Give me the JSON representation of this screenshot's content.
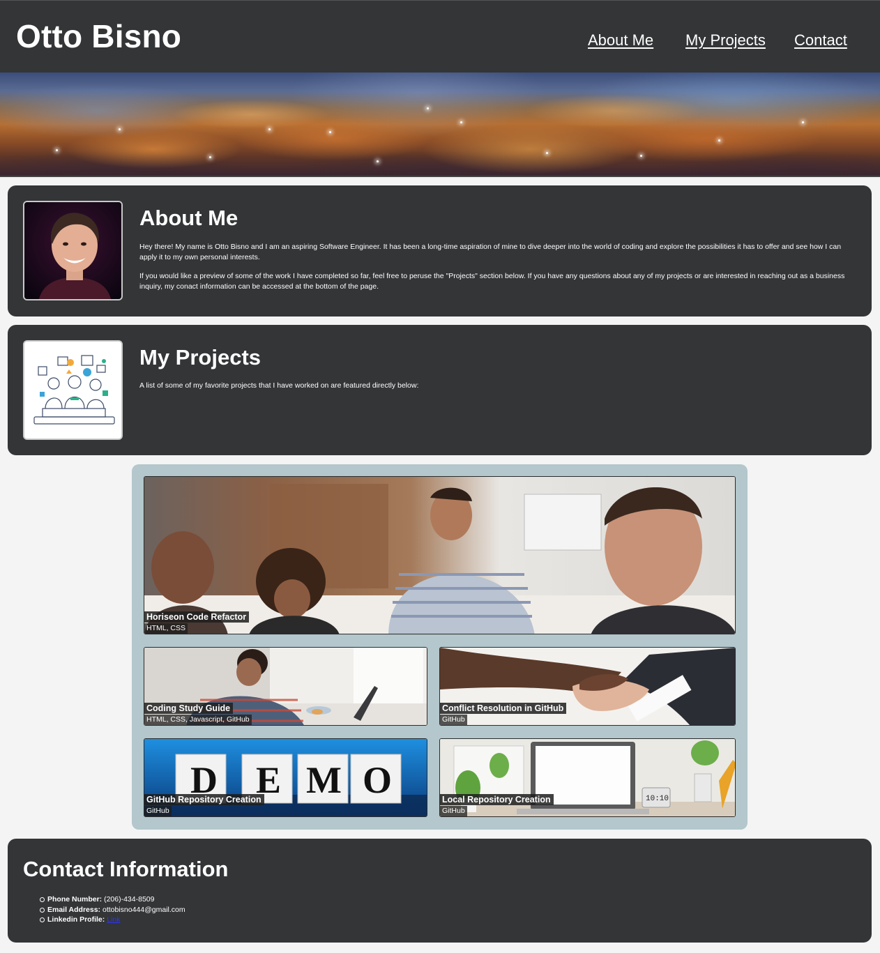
{
  "site": {
    "title": "Otto Bisno"
  },
  "nav": {
    "items": [
      {
        "label": "About Me"
      },
      {
        "label": "My Projects"
      },
      {
        "label": "Contact"
      }
    ]
  },
  "about": {
    "heading": "About Me",
    "paragraph1": "Hey there! My name is Otto Bisno and I am an aspiring Software Engineer. It has been a long-time aspiration of mine to dive deeper into the world of coding and explore the possibilities it has to offer and see how I can apply it to my own personal interests.",
    "paragraph2": "If you would like a preview of some of the work I have completed so far, feel free to peruse the \"Projects\" section below. If you have any questions about any of my projects or are interested in reaching out as a business inquiry, my conact information can be accessed at the bottom of the page."
  },
  "projects": {
    "heading": "My Projects",
    "intro": "A list of some of my favorite projects that I have worked on are featured directly below:",
    "items": [
      {
        "name": "Horiseon Code Refactor",
        "tech": "HTML, CSS"
      },
      {
        "name": "Coding Study Guide",
        "tech": "HTML, CSS, Javascript, GitHub"
      },
      {
        "name": "Conflict Resolution in GitHub",
        "tech": "GitHub"
      },
      {
        "name": "GitHub Repository Creation",
        "tech": "GitHub"
      },
      {
        "name": "Local Repository Creation",
        "tech": "GitHub"
      }
    ],
    "demo_letters": [
      "D",
      "E",
      "M",
      "O"
    ],
    "clock_text": "10:10"
  },
  "contact": {
    "heading": "Contact Information",
    "phone_label": "Phone Number:",
    "phone_value": " (206)-434-8509",
    "email_label": "Email Address:",
    "email_value": " ottobisno444@gmail.com",
    "linkedin_label": "Linkedin Profile:",
    "linkedin_link": "Link"
  },
  "colors": {
    "panel_dark": "#333537",
    "page_bg": "#f4f4f4",
    "projects_bg": "#b3c7cc",
    "link_blue": "#2b34ff"
  }
}
